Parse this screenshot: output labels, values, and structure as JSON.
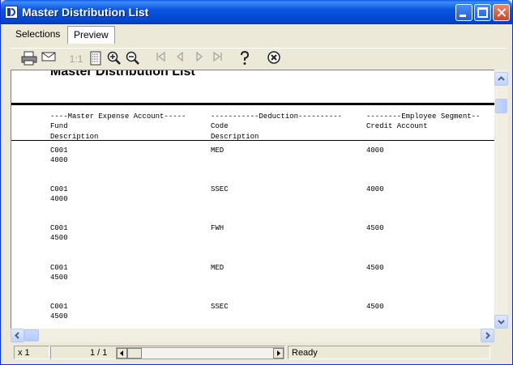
{
  "window": {
    "title": "Master Distribution List"
  },
  "tabs": [
    {
      "label": "Selections"
    },
    {
      "label": "Preview"
    }
  ],
  "toolbar": {
    "one_to_one": "1:1"
  },
  "report": {
    "title": "Master Distribution List",
    "group_headers": [
      "----Master Expense Account-----",
      "-----------Deduction----------",
      "--------Employee Segment--"
    ],
    "col1": [
      "Fund",
      "Description"
    ],
    "col2": [
      "Code",
      "Description"
    ],
    "col3": [
      "Credit Account"
    ],
    "rows": [
      {
        "fund": "C001",
        "fund_desc": "4000",
        "code": "MED",
        "credit": "4000"
      },
      {
        "fund": "C001",
        "fund_desc": "4000",
        "code": "SSEC",
        "credit": "4000"
      },
      {
        "fund": "C001",
        "fund_desc": "4500",
        "code": "FWH",
        "credit": "4500"
      },
      {
        "fund": "C001",
        "fund_desc": "4500",
        "code": "MED",
        "credit": "4500"
      },
      {
        "fund": "C001",
        "fund_desc": "4500",
        "code": "SSEC",
        "credit": "4500"
      }
    ]
  },
  "status": {
    "zoom": "x 1",
    "page": "1 / 1",
    "state": "Ready"
  },
  "colors": {
    "titlebar": "#0a56e0",
    "chrome": "#ece9d8",
    "scroll_button": "#c1d3fb"
  }
}
